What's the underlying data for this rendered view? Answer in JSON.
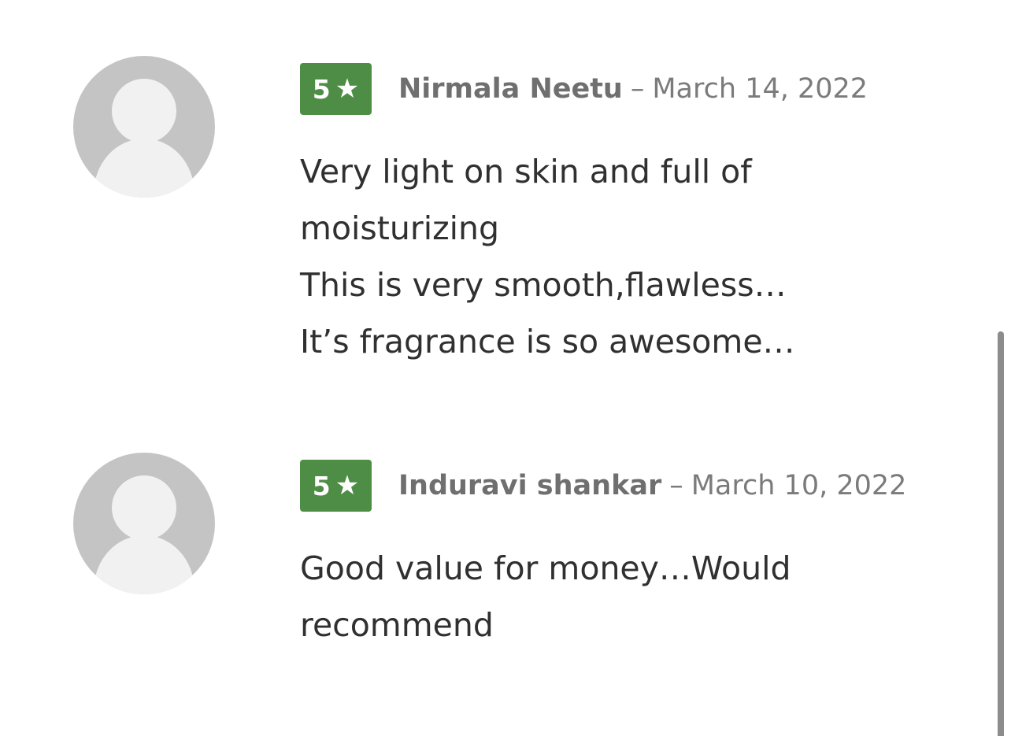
{
  "reviews": [
    {
      "rating": "5",
      "star_icon": "star-icon",
      "author": "Nirmala Neetu",
      "separator": "–",
      "date": "March 14, 2022",
      "lines": [
        "Very light on skin and full of",
        "moisturizing",
        "This is very smooth,flawless…",
        "It’s fragrance is so awesome…"
      ]
    },
    {
      "rating": "5",
      "star_icon": "star-icon",
      "author": "Induravi shankar",
      "separator": "–",
      "date": "March 10, 2022",
      "lines": [
        "Good value for money…Would",
        "recommend"
      ]
    }
  ],
  "colors": {
    "rating_badge": "#4e8d45",
    "avatar_bg": "#c4c4c4",
    "author": "#6f6f6f",
    "text": "#303030"
  }
}
